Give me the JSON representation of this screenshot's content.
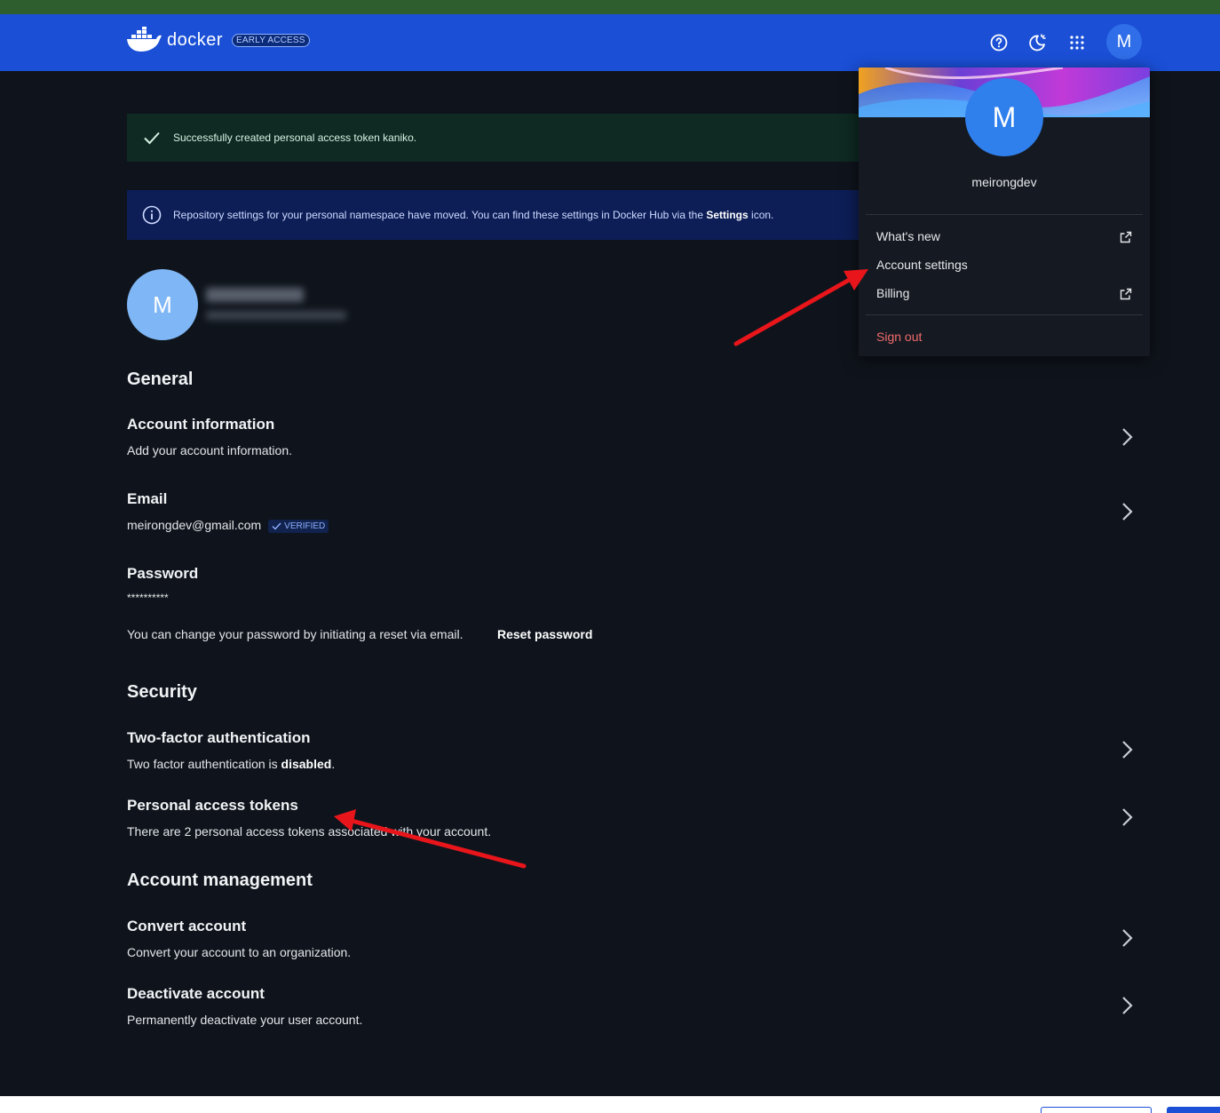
{
  "header": {
    "logo_text": "docker",
    "badge": "EARLY ACCESS",
    "avatar_initial": "M"
  },
  "alerts": {
    "success": "Successfully created personal access token kaniko.",
    "info_pre": "Repository settings for your personal namespace have moved. You can find these settings in Docker Hub via the ",
    "info_bold": "Settings",
    "info_post": " icon."
  },
  "profile": {
    "avatar_initial": "M"
  },
  "general": {
    "title": "General",
    "account_info": {
      "title": "Account information",
      "desc": "Add your account information."
    },
    "email": {
      "title": "Email",
      "value": "meirongdev@gmail.com",
      "badge": "VERIFIED"
    },
    "password": {
      "title": "Password",
      "masked": "**********",
      "desc": "You can change your password by initiating a reset via email.",
      "reset_label": "Reset password"
    }
  },
  "security": {
    "title": "Security",
    "twofa": {
      "title": "Two-factor authentication",
      "desc_pre": "Two factor authentication is ",
      "desc_bold": "disabled",
      "desc_post": "."
    },
    "tokens": {
      "title": "Personal access tokens",
      "desc": "There are 2 personal access tokens associated with your account."
    }
  },
  "management": {
    "title": "Account management",
    "convert": {
      "title": "Convert account",
      "desc": "Convert your account to an organization."
    },
    "deactivate": {
      "title": "Deactivate account",
      "desc": "Permanently deactivate your user account."
    }
  },
  "dropdown": {
    "avatar_initial": "M",
    "username": "meirongdev",
    "items": [
      {
        "label": "What's new",
        "external": true
      },
      {
        "label": "Account settings",
        "external": false
      },
      {
        "label": "Billing",
        "external": true
      }
    ],
    "sign_out": "Sign out"
  },
  "colors": {
    "header_bg": "#1a4fd6",
    "page_bg": "#0f141c",
    "success_bg": "#0e2a22",
    "info_bg": "#0d1e57",
    "sign_out": "#f26b6b",
    "annotation_arrow": "#e8151b"
  },
  "icons": {
    "help": "help-circle-icon",
    "theme": "theme-toggle-icon",
    "apps": "apps-grid-icon",
    "check": "check-icon",
    "info": "info-icon",
    "chevron": "chevron-right-icon",
    "external": "external-link-icon"
  }
}
